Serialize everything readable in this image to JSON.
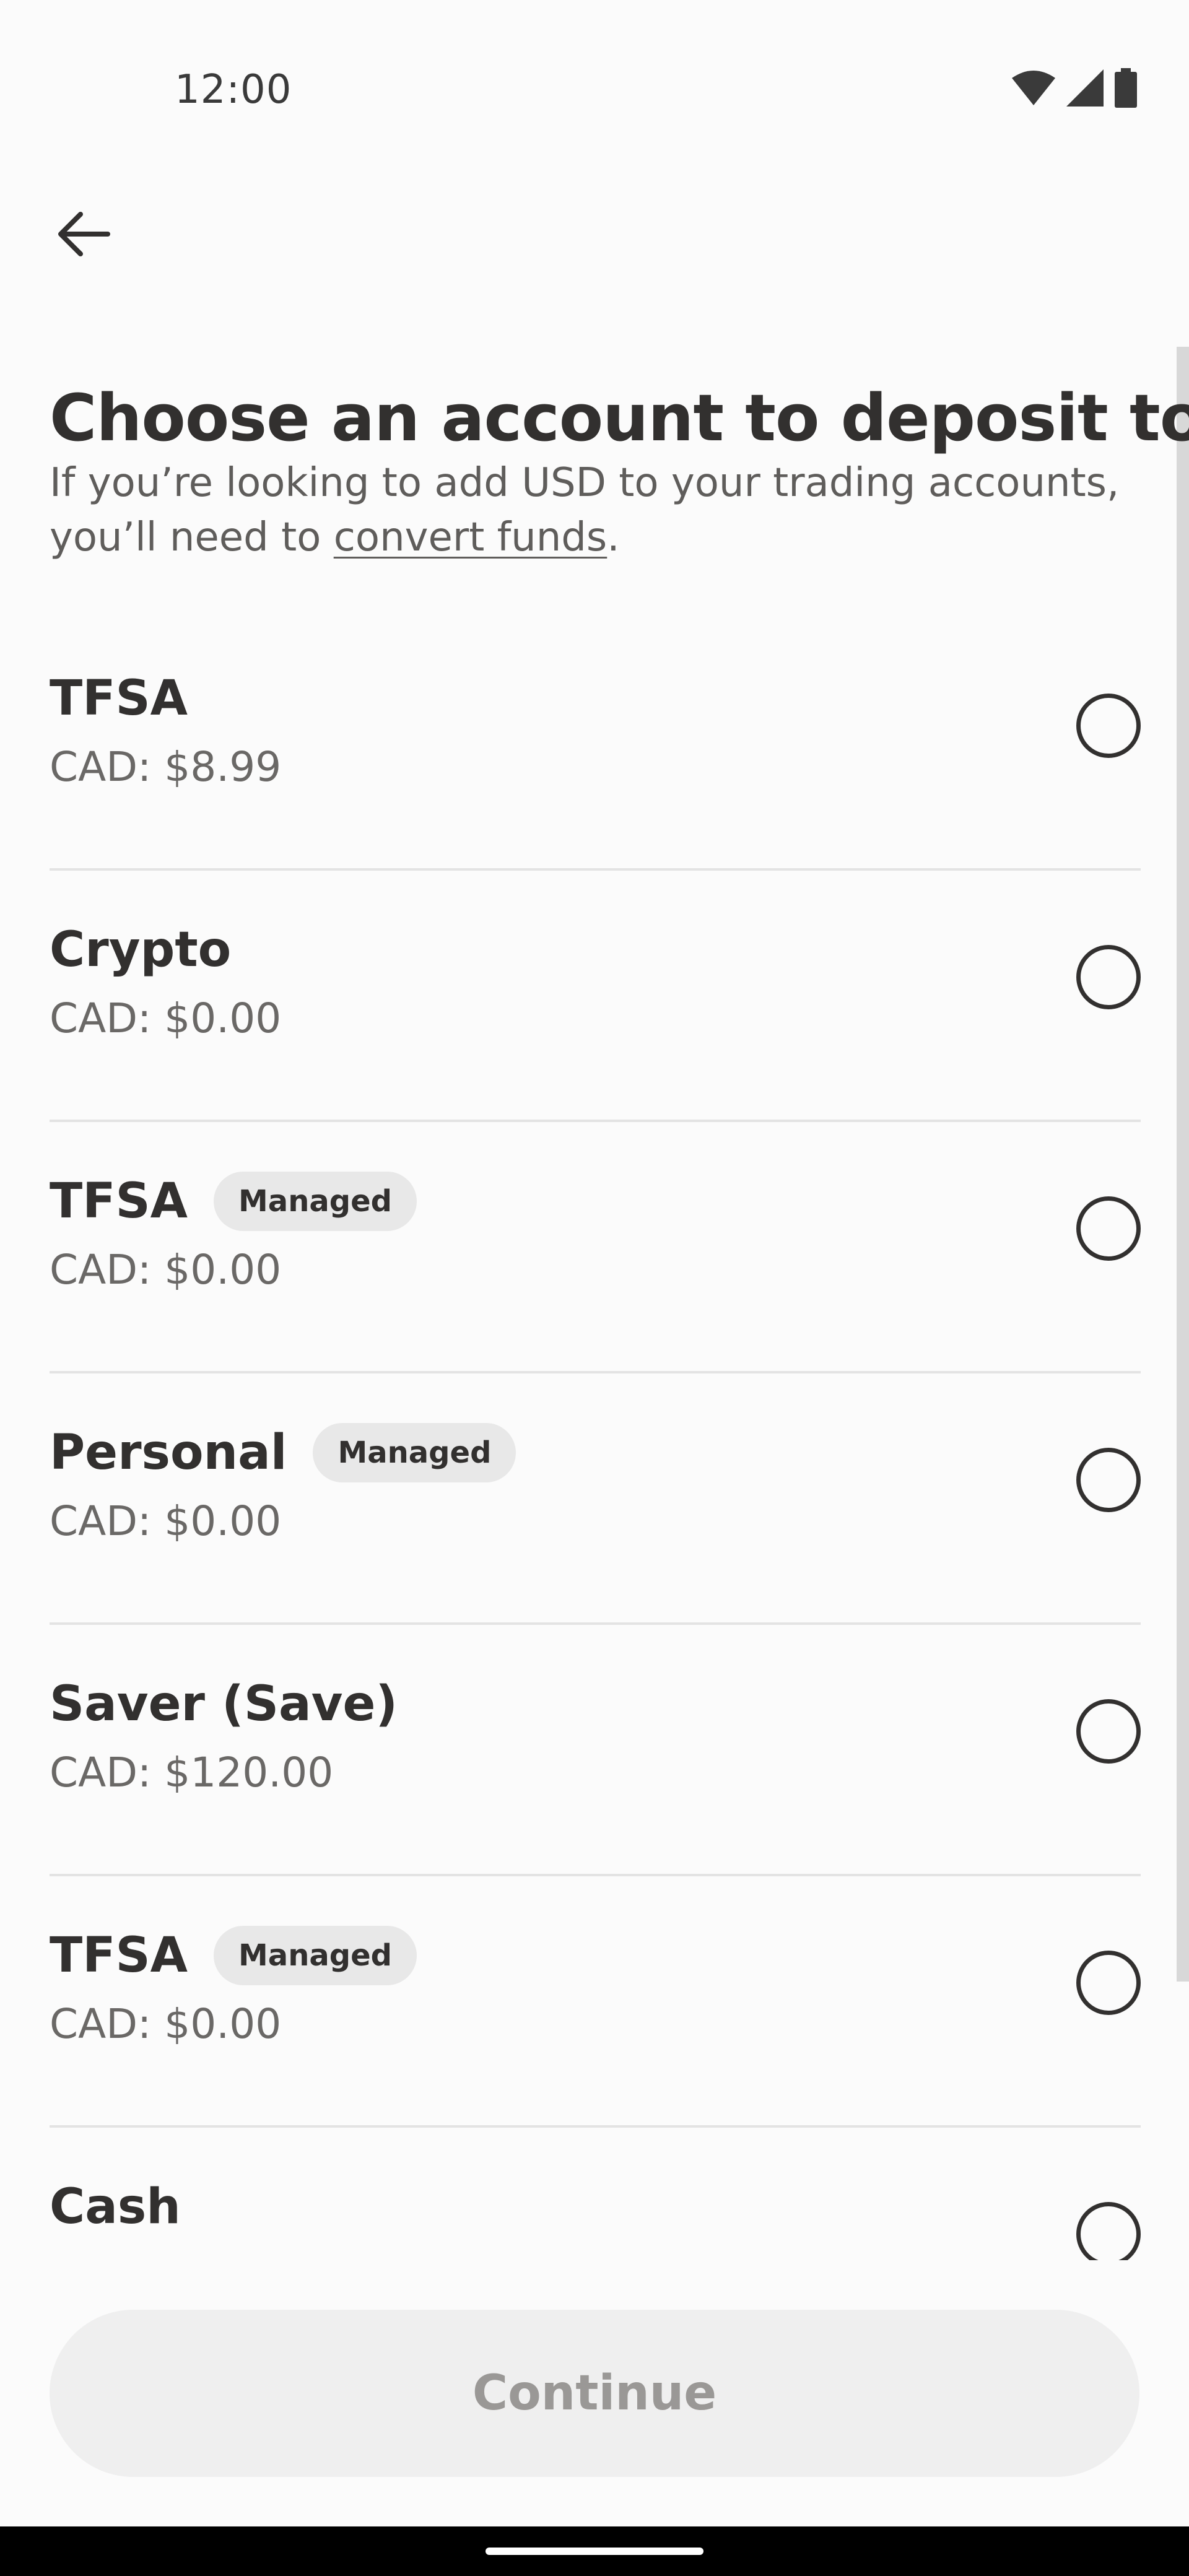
{
  "status_bar": {
    "time": "12:00",
    "icons": [
      "wifi-icon",
      "cellular-signal-icon",
      "battery-icon"
    ]
  },
  "nav": {
    "back_icon": "arrow-left-icon"
  },
  "header": {
    "title": "Choose an account to deposit to",
    "subtitle_before": "If you’re looking to add USD to your trading accounts, you’ll need to ",
    "subtitle_link": "convert funds",
    "subtitle_after": "."
  },
  "accounts": [
    {
      "name": "TFSA",
      "badge": "",
      "balance": "CAD: $8.99",
      "selected": false
    },
    {
      "name": "Crypto",
      "badge": "",
      "balance": "CAD: $0.00",
      "selected": false
    },
    {
      "name": "TFSA",
      "badge": "Managed",
      "balance": "CAD: $0.00",
      "selected": false
    },
    {
      "name": "Personal",
      "badge": "Managed",
      "balance": "CAD: $0.00",
      "selected": false
    },
    {
      "name": "Saver (Save)",
      "badge": "",
      "balance": "CAD: $120.00",
      "selected": false
    },
    {
      "name": "TFSA",
      "badge": "Managed",
      "balance": "CAD: $0.00",
      "selected": false
    },
    {
      "name": "Cash",
      "badge": "",
      "balance": "",
      "selected": false
    }
  ],
  "footer": {
    "continue_label": "Continue",
    "continue_enabled": false
  },
  "colors": {
    "background": "#fbfbfb",
    "text_primary": "#32302f",
    "text_secondary": "#6a6866",
    "badge_bg": "#e8e8e8",
    "divider": "#e3e3e3",
    "button_disabled_bg": "#efefef",
    "button_disabled_text": "#9a9896"
  }
}
